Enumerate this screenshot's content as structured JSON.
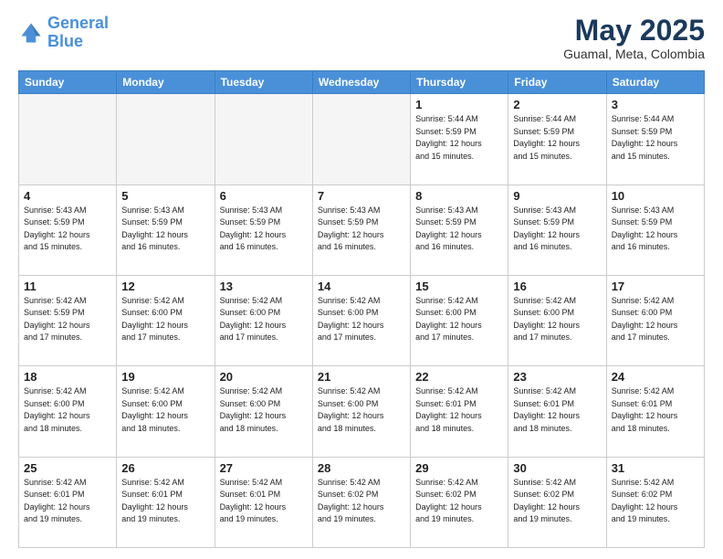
{
  "logo": {
    "line1": "General",
    "line2": "Blue"
  },
  "title": "May 2025",
  "subtitle": "Guamal, Meta, Colombia",
  "weekdays": [
    "Sunday",
    "Monday",
    "Tuesday",
    "Wednesday",
    "Thursday",
    "Friday",
    "Saturday"
  ],
  "rows": [
    [
      {
        "day": "",
        "info": ""
      },
      {
        "day": "",
        "info": ""
      },
      {
        "day": "",
        "info": ""
      },
      {
        "day": "",
        "info": ""
      },
      {
        "day": "1",
        "info": "Sunrise: 5:44 AM\nSunset: 5:59 PM\nDaylight: 12 hours\nand 15 minutes."
      },
      {
        "day": "2",
        "info": "Sunrise: 5:44 AM\nSunset: 5:59 PM\nDaylight: 12 hours\nand 15 minutes."
      },
      {
        "day": "3",
        "info": "Sunrise: 5:44 AM\nSunset: 5:59 PM\nDaylight: 12 hours\nand 15 minutes."
      }
    ],
    [
      {
        "day": "4",
        "info": "Sunrise: 5:43 AM\nSunset: 5:59 PM\nDaylight: 12 hours\nand 15 minutes."
      },
      {
        "day": "5",
        "info": "Sunrise: 5:43 AM\nSunset: 5:59 PM\nDaylight: 12 hours\nand 16 minutes."
      },
      {
        "day": "6",
        "info": "Sunrise: 5:43 AM\nSunset: 5:59 PM\nDaylight: 12 hours\nand 16 minutes."
      },
      {
        "day": "7",
        "info": "Sunrise: 5:43 AM\nSunset: 5:59 PM\nDaylight: 12 hours\nand 16 minutes."
      },
      {
        "day": "8",
        "info": "Sunrise: 5:43 AM\nSunset: 5:59 PM\nDaylight: 12 hours\nand 16 minutes."
      },
      {
        "day": "9",
        "info": "Sunrise: 5:43 AM\nSunset: 5:59 PM\nDaylight: 12 hours\nand 16 minutes."
      },
      {
        "day": "10",
        "info": "Sunrise: 5:43 AM\nSunset: 5:59 PM\nDaylight: 12 hours\nand 16 minutes."
      }
    ],
    [
      {
        "day": "11",
        "info": "Sunrise: 5:42 AM\nSunset: 5:59 PM\nDaylight: 12 hours\nand 17 minutes."
      },
      {
        "day": "12",
        "info": "Sunrise: 5:42 AM\nSunset: 6:00 PM\nDaylight: 12 hours\nand 17 minutes."
      },
      {
        "day": "13",
        "info": "Sunrise: 5:42 AM\nSunset: 6:00 PM\nDaylight: 12 hours\nand 17 minutes."
      },
      {
        "day": "14",
        "info": "Sunrise: 5:42 AM\nSunset: 6:00 PM\nDaylight: 12 hours\nand 17 minutes."
      },
      {
        "day": "15",
        "info": "Sunrise: 5:42 AM\nSunset: 6:00 PM\nDaylight: 12 hours\nand 17 minutes."
      },
      {
        "day": "16",
        "info": "Sunrise: 5:42 AM\nSunset: 6:00 PM\nDaylight: 12 hours\nand 17 minutes."
      },
      {
        "day": "17",
        "info": "Sunrise: 5:42 AM\nSunset: 6:00 PM\nDaylight: 12 hours\nand 17 minutes."
      }
    ],
    [
      {
        "day": "18",
        "info": "Sunrise: 5:42 AM\nSunset: 6:00 PM\nDaylight: 12 hours\nand 18 minutes."
      },
      {
        "day": "19",
        "info": "Sunrise: 5:42 AM\nSunset: 6:00 PM\nDaylight: 12 hours\nand 18 minutes."
      },
      {
        "day": "20",
        "info": "Sunrise: 5:42 AM\nSunset: 6:00 PM\nDaylight: 12 hours\nand 18 minutes."
      },
      {
        "day": "21",
        "info": "Sunrise: 5:42 AM\nSunset: 6:00 PM\nDaylight: 12 hours\nand 18 minutes."
      },
      {
        "day": "22",
        "info": "Sunrise: 5:42 AM\nSunset: 6:01 PM\nDaylight: 12 hours\nand 18 minutes."
      },
      {
        "day": "23",
        "info": "Sunrise: 5:42 AM\nSunset: 6:01 PM\nDaylight: 12 hours\nand 18 minutes."
      },
      {
        "day": "24",
        "info": "Sunrise: 5:42 AM\nSunset: 6:01 PM\nDaylight: 12 hours\nand 18 minutes."
      }
    ],
    [
      {
        "day": "25",
        "info": "Sunrise: 5:42 AM\nSunset: 6:01 PM\nDaylight: 12 hours\nand 19 minutes."
      },
      {
        "day": "26",
        "info": "Sunrise: 5:42 AM\nSunset: 6:01 PM\nDaylight: 12 hours\nand 19 minutes."
      },
      {
        "day": "27",
        "info": "Sunrise: 5:42 AM\nSunset: 6:01 PM\nDaylight: 12 hours\nand 19 minutes."
      },
      {
        "day": "28",
        "info": "Sunrise: 5:42 AM\nSunset: 6:02 PM\nDaylight: 12 hours\nand 19 minutes."
      },
      {
        "day": "29",
        "info": "Sunrise: 5:42 AM\nSunset: 6:02 PM\nDaylight: 12 hours\nand 19 minutes."
      },
      {
        "day": "30",
        "info": "Sunrise: 5:42 AM\nSunset: 6:02 PM\nDaylight: 12 hours\nand 19 minutes."
      },
      {
        "day": "31",
        "info": "Sunrise: 5:42 AM\nSunset: 6:02 PM\nDaylight: 12 hours\nand 19 minutes."
      }
    ]
  ]
}
